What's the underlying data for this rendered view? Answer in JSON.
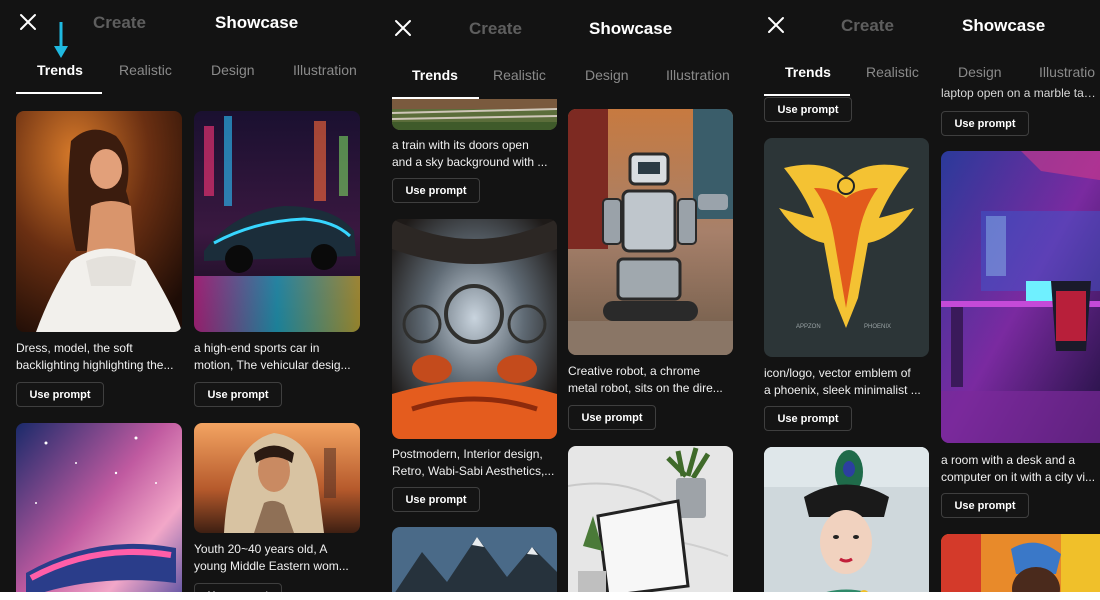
{
  "header": {
    "create_label": "Create",
    "showcase_label": "Showcase",
    "close_icon": "close-icon"
  },
  "tabs": [
    "Trends",
    "Realistic",
    "Design",
    "Illustration"
  ],
  "tabs_clipped": "Illustratio",
  "indicator": {
    "icon": "arrow-down-icon",
    "color": "#1fb9e0"
  },
  "button_label": "Use prompt",
  "panel1": {
    "cards": [
      {
        "caption": [
          "Dress, model, the soft",
          "backlighting highlighting the..."
        ]
      },
      {
        "caption": [
          "a high-end sports car in",
          "motion, The vehicular desig..."
        ]
      },
      {
        "caption": []
      },
      {
        "caption": [
          "Youth 20~40 years old, A",
          "young Middle Eastern wom..."
        ]
      }
    ]
  },
  "panel2": {
    "cards": [
      {
        "caption": [
          "a train with its doors open",
          "and a sky background with ..."
        ]
      },
      {
        "caption": [
          "Creative robot, a chrome",
          "metal robot, sits on the dire..."
        ]
      },
      {
        "caption": [
          "Postmodern, Interior design,",
          "Retro, Wabi-Sabi Aesthetics,..."
        ]
      }
    ]
  },
  "panel3": {
    "cards": [
      {
        "caption": [
          "laptop open on a marble tab..."
        ]
      },
      {
        "caption": [
          "icon/logo, vector emblem of",
          "a phoenix, sleek minimalist ..."
        ]
      },
      {
        "caption": [
          "a room with a desk and a",
          "computer on it with a city vi..."
        ]
      }
    ],
    "emblem_text": [
      "APPZON",
      "PHOENIX"
    ]
  }
}
